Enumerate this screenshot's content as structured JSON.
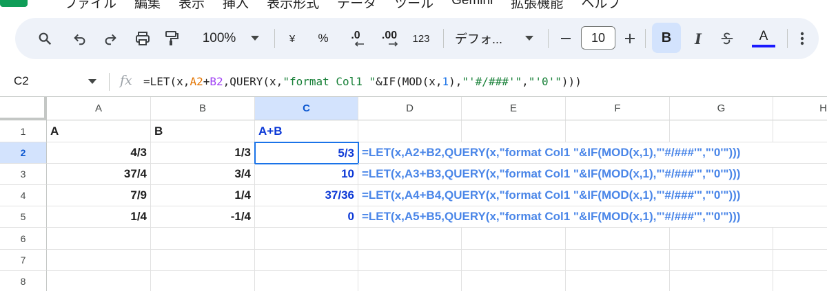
{
  "menu": [
    "ファイル",
    "編集",
    "表示",
    "挿入",
    "表示形式",
    "データ",
    "ツール",
    "Gemini",
    "拡張機能",
    "ヘルプ"
  ],
  "toolbar": {
    "zoom": "100%",
    "currency": "¥",
    "percent": "%",
    "decrease_decimal": ".0",
    "increase_decimal": ".00",
    "number_format": "123",
    "font": "デフォ...",
    "font_size": "10",
    "bold": "B",
    "italic": "I",
    "text_color": "A"
  },
  "formula_bar": {
    "name_box": "C2",
    "fx": "fx",
    "formula_parts": [
      "=LET(x,",
      "A2",
      "+",
      "B2",
      ",QUERY(x,",
      "\"format Col1 \"",
      "&IF(MOD(x,",
      "1",
      "),",
      "\"'#/###'\"",
      ",",
      "\"'0'\"",
      ")))"
    ]
  },
  "columns": [
    "A",
    "B",
    "C",
    "D",
    "E",
    "F",
    "G",
    "H"
  ],
  "rows": [
    "1",
    "2",
    "3",
    "4",
    "5",
    "6",
    "7",
    "8"
  ],
  "cells": {
    "header": {
      "A": "A",
      "B": "B",
      "C": "A+B"
    },
    "data": [
      {
        "A": "4/3",
        "B": "1/3",
        "C": "5/3",
        "D": "=LET(x,A2+B2,QUERY(x,\"format Col1 \"&IF(MOD(x,1),\"'#/###'\",\"'0'\")))"
      },
      {
        "A": "37/4",
        "B": "3/4",
        "C": "10",
        "D": "=LET(x,A3+B3,QUERY(x,\"format Col1 \"&IF(MOD(x,1),\"'#/###'\",\"'0'\")))"
      },
      {
        "A": "7/9",
        "B": "1/4",
        "C": "37/36",
        "D": "=LET(x,A4+B4,QUERY(x,\"format Col1 \"&IF(MOD(x,1),\"'#/###'\",\"'0'\")))"
      },
      {
        "A": "1/4",
        "B": "-1/4",
        "C": "0",
        "D": "=LET(x,A5+B5,QUERY(x,\"format Col1 \"&IF(MOD(x,1),\"'#/###'\",\"'0'\")))"
      }
    ]
  },
  "colors": {
    "accent": "#1a73e8",
    "selection": "#d3e3fd",
    "sum_text": "#0b38d6",
    "formula_text": "#4a86e8"
  }
}
